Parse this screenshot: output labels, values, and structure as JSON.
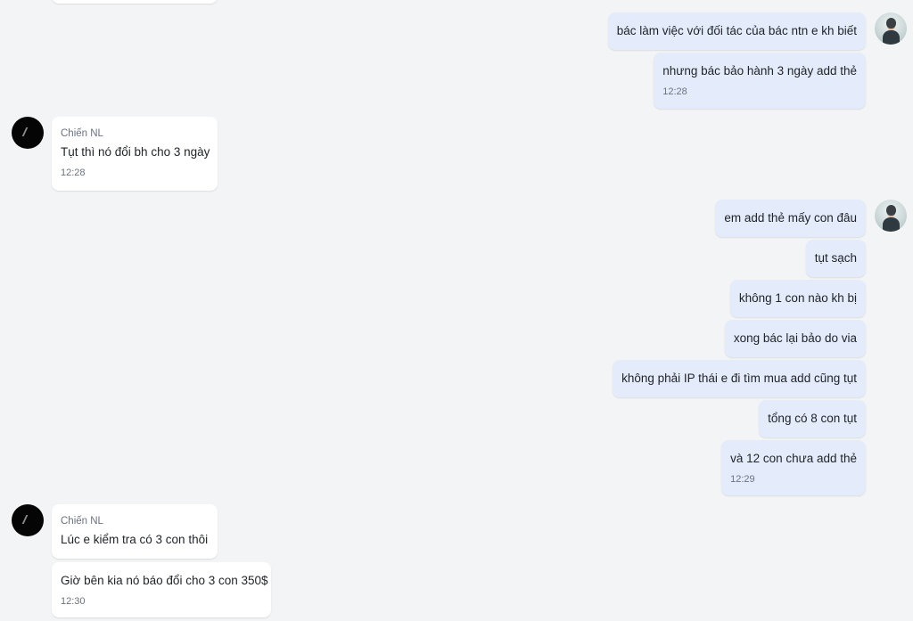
{
  "messages": {
    "m1": {
      "text": "bác làm việc với đối tác của bác ntn e kh biết"
    },
    "m2": {
      "text": "nhưng bác bảo hành 3 ngày add thẻ",
      "time": "12:28"
    },
    "m3": {
      "sender": "Chiến NL",
      "text": "Tụt thì nó đổi bh cho 3 ngày",
      "time": "12:28"
    },
    "m4": {
      "text": "em add thẻ mấy con đâu"
    },
    "m5": {
      "text": "tụt sạch"
    },
    "m6": {
      "text": "không 1 con nào kh bị"
    },
    "m7": {
      "text": "xong bác lại bảo do via"
    },
    "m8": {
      "text": "không phải IP thái e đi tìm mua add cũng tụt"
    },
    "m9": {
      "text": "tổng có 8 con tụt"
    },
    "m10": {
      "text": "và 12 con chưa add thẻ",
      "time": "12:29"
    },
    "m11": {
      "sender": "Chiến NL",
      "text": "Lúc e kiểm tra có 3 con thôi"
    },
    "m12": {
      "text": "Giờ bên kia nó báo đổi cho 3 con 350$",
      "time": "12:30"
    }
  },
  "avatars": {
    "me": "user-photo-avatar",
    "contact": "contact-black-avatar"
  },
  "colors": {
    "background": "#f3f4f6",
    "incoming_bubble": "#ffffff",
    "outgoing_bubble": "#e4ecfb",
    "meta_text": "#6b7280"
  }
}
